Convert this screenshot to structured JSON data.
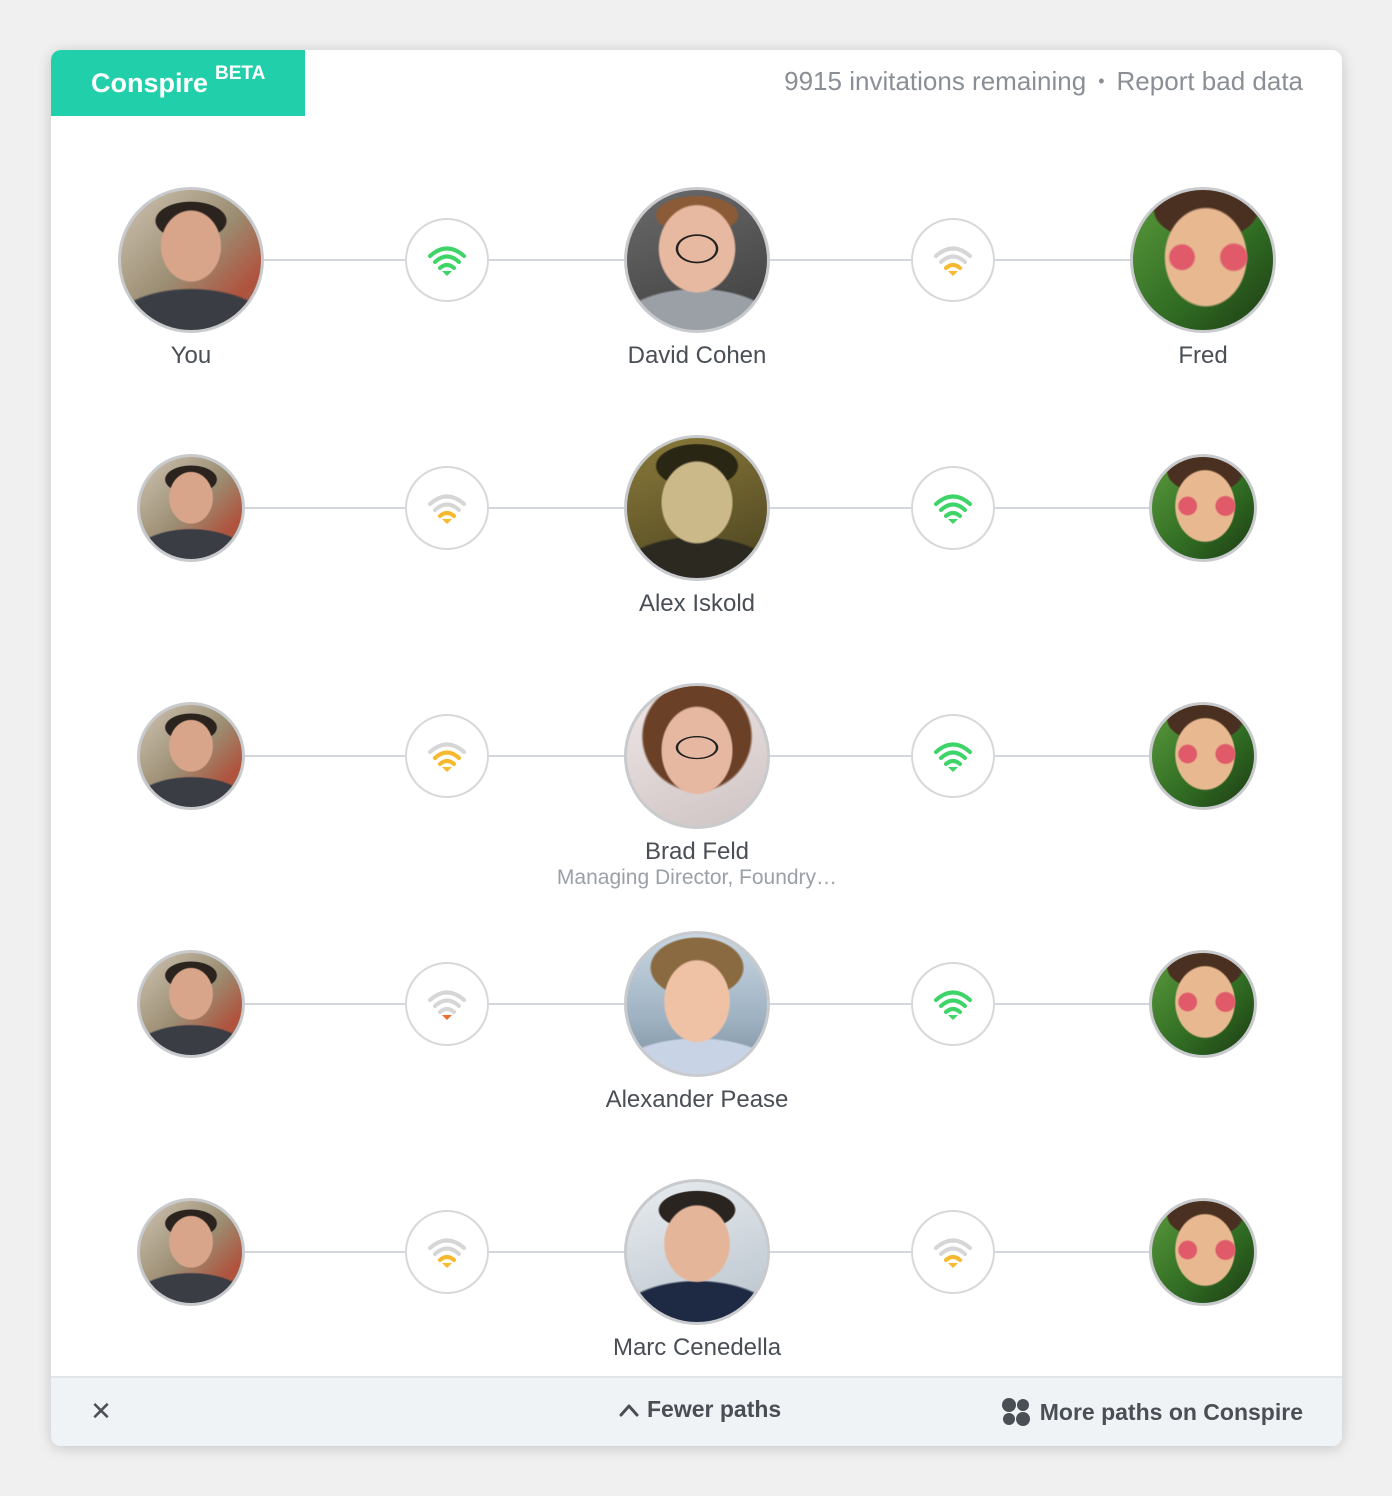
{
  "brand": {
    "name": "Conspire",
    "badge": "BETA"
  },
  "header": {
    "invitations": "9915 invitations remaining",
    "separator": "•",
    "report": "Report bad data"
  },
  "colors": {
    "accent": "#21cfaa",
    "signal_green": "#3fd468",
    "signal_yellow": "#f5b82e",
    "signal_orange": "#f06c2e",
    "signal_gray": "#d6d6d6"
  },
  "paths": [
    {
      "you": {
        "label": "You",
        "avatar": "you-photo"
      },
      "link1": {
        "strength": 3,
        "color": "green"
      },
      "mid": {
        "name": "David Cohen",
        "subtitle": "",
        "avatar": "david-cohen-photo"
      },
      "link2": {
        "strength": 1,
        "color": "yellow"
      },
      "target": {
        "label": "Fred",
        "avatar": "fred-drawing"
      }
    },
    {
      "you": {
        "label": "",
        "avatar": "you-photo"
      },
      "link1": {
        "strength": 1,
        "color": "yellow"
      },
      "mid": {
        "name": "Alex Iskold",
        "subtitle": "",
        "avatar": "alex-iskold-photo"
      },
      "link2": {
        "strength": 3,
        "color": "green"
      },
      "target": {
        "label": "",
        "avatar": "fred-drawing"
      }
    },
    {
      "you": {
        "label": "",
        "avatar": "you-photo"
      },
      "link1": {
        "strength": 2,
        "color": "yellow"
      },
      "mid": {
        "name": "Brad Feld",
        "subtitle": "Managing Director, Foundry…",
        "avatar": "brad-feld-photo"
      },
      "link2": {
        "strength": 3,
        "color": "green"
      },
      "target": {
        "label": "",
        "avatar": "fred-drawing"
      }
    },
    {
      "you": {
        "label": "",
        "avatar": "you-photo"
      },
      "link1": {
        "strength": 0,
        "color": "orange"
      },
      "mid": {
        "name": "Alexander Pease",
        "subtitle": "",
        "avatar": "alexander-pease-photo"
      },
      "link2": {
        "strength": 3,
        "color": "green"
      },
      "target": {
        "label": "",
        "avatar": "fred-drawing"
      }
    },
    {
      "you": {
        "label": "",
        "avatar": "you-photo"
      },
      "link1": {
        "strength": 1,
        "color": "yellow"
      },
      "mid": {
        "name": "Marc Cenedella",
        "subtitle": "",
        "avatar": "marc-cenedella-photo"
      },
      "link2": {
        "strength": 1,
        "color": "yellow"
      },
      "target": {
        "label": "",
        "avatar": "fred-drawing"
      }
    }
  ],
  "footer": {
    "close_icon": "close-icon",
    "fewer_label": "Fewer paths",
    "fewer_icon": "chevron-up-icon",
    "more_label": "More paths on Conspire",
    "more_icon": "conspire-logo-icon"
  }
}
